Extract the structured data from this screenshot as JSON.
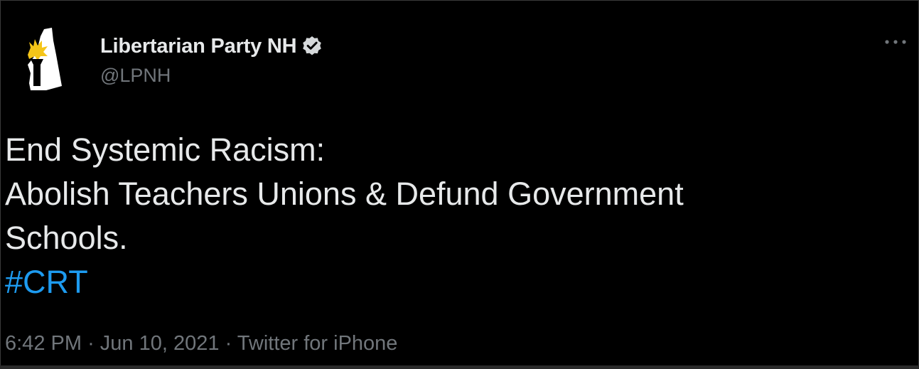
{
  "tweet": {
    "display_name": "Libertarian Party NH",
    "handle": "@LPNH",
    "avatar_icon": "lpnh-logo-icon",
    "verified_icon": "verified-badge-icon",
    "more_icon": "more-options-icon",
    "text_lines": [
      "End Systemic Racism:",
      "Abolish Teachers Unions & Defund Government",
      "Schools."
    ],
    "hashtag": "#CRT",
    "meta": {
      "time": "6:42 PM",
      "separator": "·",
      "date": "Jun 10, 2021",
      "source": "Twitter for iPhone"
    }
  },
  "colors": {
    "background": "#000000",
    "text": "#e7e9ea",
    "secondary": "#71767b",
    "link": "#1d9bf0",
    "logo_yellow": "#f5c518"
  }
}
